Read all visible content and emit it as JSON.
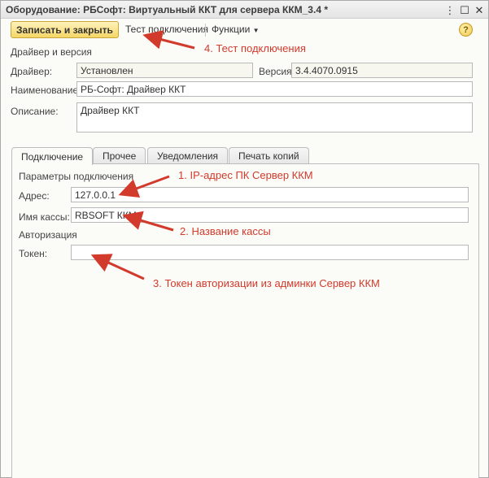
{
  "window": {
    "title": "Оборудование: РБСофт: Виртуальный ККТ для сервера ККМ_3.4 *"
  },
  "titlebar_buttons": {
    "more": "⋮",
    "maximize": "☐",
    "close": "✕"
  },
  "toolbar": {
    "save_close": "Записать и закрыть",
    "test_connection": "Тест подключения",
    "functions": "Функции",
    "help": "?"
  },
  "driver_section": {
    "heading": "Драйвер и версия",
    "driver_label": "Драйвер:",
    "driver_value": "Установлен",
    "version_label": "Версия:",
    "version_value": "3.4.4070.0915",
    "name_label": "Наименование:",
    "name_value": "РБ-Софт: Драйвер ККТ",
    "description_label": "Описание:",
    "description_value": "Драйвер ККТ"
  },
  "tabs": [
    {
      "label": "Подключение",
      "active": true
    },
    {
      "label": "Прочее",
      "active": false
    },
    {
      "label": "Уведомления",
      "active": false
    },
    {
      "label": "Печать копий",
      "active": false
    }
  ],
  "connection": {
    "heading": "Параметры подключения",
    "address_label": "Адрес:",
    "address_value": "127.0.0.1",
    "register_name_label": "Имя кассы:",
    "register_name_value": "RBSOFT ККМ",
    "auth_heading": "Авторизация",
    "token_label": "Токен:",
    "token_value": ""
  },
  "annotations": {
    "a1": "1. IP-адрес ПК Сервер ККМ",
    "a2": "2. Название кассы",
    "a3": "3. Токен авторизации из админки Сервер ККМ",
    "a4": "4. Тест подключения"
  },
  "colors": {
    "annotation": "#d23a2c",
    "save_button": "#f5d665"
  }
}
